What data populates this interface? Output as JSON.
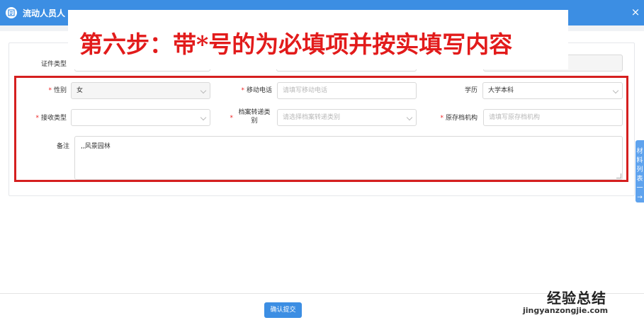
{
  "window": {
    "title": "流动人员人",
    "close_glyph": "×"
  },
  "caption": {
    "text": "第六步：带*号的为必填项并按实填写内容",
    "color": "#e21b1b"
  },
  "form": {
    "row0": {
      "id_type_label": "证件类型"
    },
    "required_mark": "*",
    "gender": {
      "label": "性别",
      "value": "女"
    },
    "mobile": {
      "label": "移动电话",
      "placeholder": "请填写移动电话"
    },
    "education": {
      "label": "学历",
      "value": "大学本科"
    },
    "receive_type": {
      "label": "接收类型",
      "value": ""
    },
    "archive_transfer": {
      "label_line1": "档案转递类",
      "label_line2": "别",
      "placeholder": "请选择档案转递类别"
    },
    "original_archive": {
      "label": "原存档机构",
      "placeholder": "请填写原存档机构"
    },
    "remark": {
      "label": "备注",
      "value": ",,风景园林"
    }
  },
  "side_tab": {
    "chars": [
      "材",
      "料",
      "列",
      "表",
      "一",
      "→"
    ]
  },
  "footer": {
    "confirm_label": "确认提交"
  },
  "watermark": {
    "brand": "经验总结",
    "url": "jingyanzongjie.com"
  },
  "colors": {
    "accent": "#3c8ee3",
    "highlight_border": "#d51f1f",
    "required": "#e22222"
  }
}
